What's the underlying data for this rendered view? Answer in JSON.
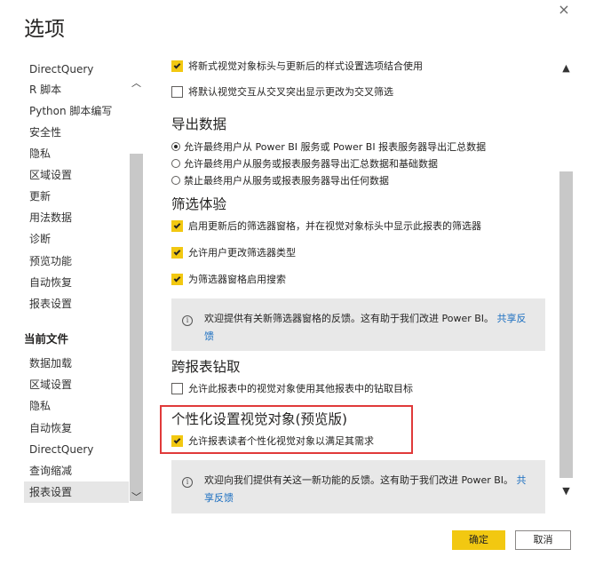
{
  "dialog": {
    "title": "选项",
    "close_glyph": "×"
  },
  "nav": {
    "items_global": [
      "DirectQuery",
      "R 脚本",
      "Python 脚本编写",
      "安全性",
      "隐私",
      "区域设置",
      "更新",
      "用法数据",
      "诊断",
      "预览功能",
      "自动恢复",
      "报表设置"
    ],
    "section_current": "当前文件",
    "items_current": [
      "数据加载",
      "区域设置",
      "隐私",
      "自动恢复",
      "DirectQuery",
      "查询缩减",
      "报表设置"
    ],
    "selected": "报表设置"
  },
  "content": {
    "top_options": [
      {
        "label": "将新式视觉对象标头与更新后的样式设置选项结合使用",
        "checked": true
      },
      {
        "label": "将默认视觉交互从交叉突出显示更改为交叉筛选",
        "checked": false
      }
    ],
    "export": {
      "title": "导出数据",
      "options": [
        {
          "label": "允许最终用户从 Power BI 服务或 Power BI 报表服务器导出汇总数据",
          "selected": true
        },
        {
          "label": "允许最终用户从服务或报表服务器导出汇总数据和基础数据",
          "selected": false
        },
        {
          "label": "禁止最终用户从服务或报表服务器导出任何数据",
          "selected": false
        }
      ]
    },
    "filter": {
      "title": "筛选体验",
      "options": [
        {
          "label": "启用更新后的筛选器窗格，并在视觉对象标头中显示此报表的筛选器",
          "checked": true
        },
        {
          "label": "允许用户更改筛选器类型",
          "checked": true
        },
        {
          "label": "为筛选器窗格启用搜索",
          "checked": true
        }
      ],
      "info_text": "欢迎提供有关新筛选器窗格的反馈。这有助于我们改进 Power BI。",
      "info_link": "共享反馈"
    },
    "drill": {
      "title": "跨报表钻取",
      "options": [
        {
          "label": "允许此报表中的视觉对象使用其他报表中的钻取目标",
          "checked": false
        }
      ]
    },
    "personalize": {
      "title": "个性化设置视觉对象(预览版)",
      "options": [
        {
          "label": "允许报表读者个性化视觉对象以满足其需求",
          "checked": true
        }
      ],
      "info_text": "欢迎向我们提供有关这一新功能的反馈。这有助于我们改进 Power BI。",
      "info_link": "共享反馈"
    }
  },
  "footer": {
    "ok_label": "确定",
    "cancel_label": "取消"
  },
  "colors": {
    "accent": "#f2c811",
    "highlight": "#e03a3a",
    "link": "#1a6ec0"
  }
}
